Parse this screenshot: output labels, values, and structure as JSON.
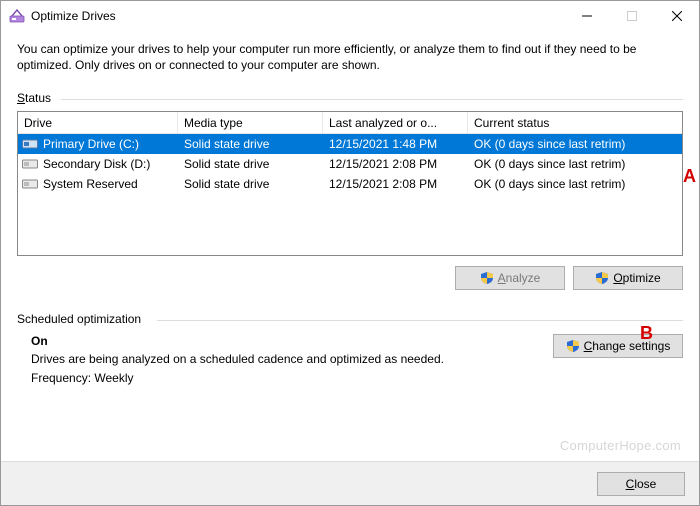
{
  "window": {
    "title": "Optimize Drives",
    "description": "You can optimize your drives to help your computer run more efficiently, or analyze them to find out if they need to be optimized. Only drives on or connected to your computer are shown."
  },
  "status": {
    "label_prefix": "S",
    "label_rest": "tatus",
    "columns": {
      "drive": "Drive",
      "media": "Media type",
      "last": "Last analyzed or o...",
      "status": "Current status"
    },
    "rows": [
      {
        "name": "Primary Drive (C:)",
        "media": "Solid state drive",
        "last": "12/15/2021 1:48 PM",
        "status": "OK (0 days since last retrim)",
        "selected": true
      },
      {
        "name": "Secondary Disk (D:)",
        "media": "Solid state drive",
        "last": "12/15/2021 2:08 PM",
        "status": "OK (0 days since last retrim)",
        "selected": false
      },
      {
        "name": "System Reserved",
        "media": "Solid state drive",
        "last": "12/15/2021 2:08 PM",
        "status": "OK (0 days since last retrim)",
        "selected": false
      }
    ]
  },
  "buttons": {
    "analyze_prefix": "A",
    "analyze_rest": "nalyze",
    "optimize_prefix": "O",
    "optimize_rest": "ptimize",
    "change_prefix": "C",
    "change_rest": "hange settings",
    "close_prefix": "C",
    "close_rest": "lose"
  },
  "scheduled": {
    "title": "Scheduled optimization",
    "state": "On",
    "desc": "Drives are being analyzed on a scheduled cadence and optimized as needed.",
    "freq": "Frequency: Weekly"
  },
  "watermark": "ComputerHope.com",
  "annotations": {
    "a": "A",
    "b": "B"
  }
}
